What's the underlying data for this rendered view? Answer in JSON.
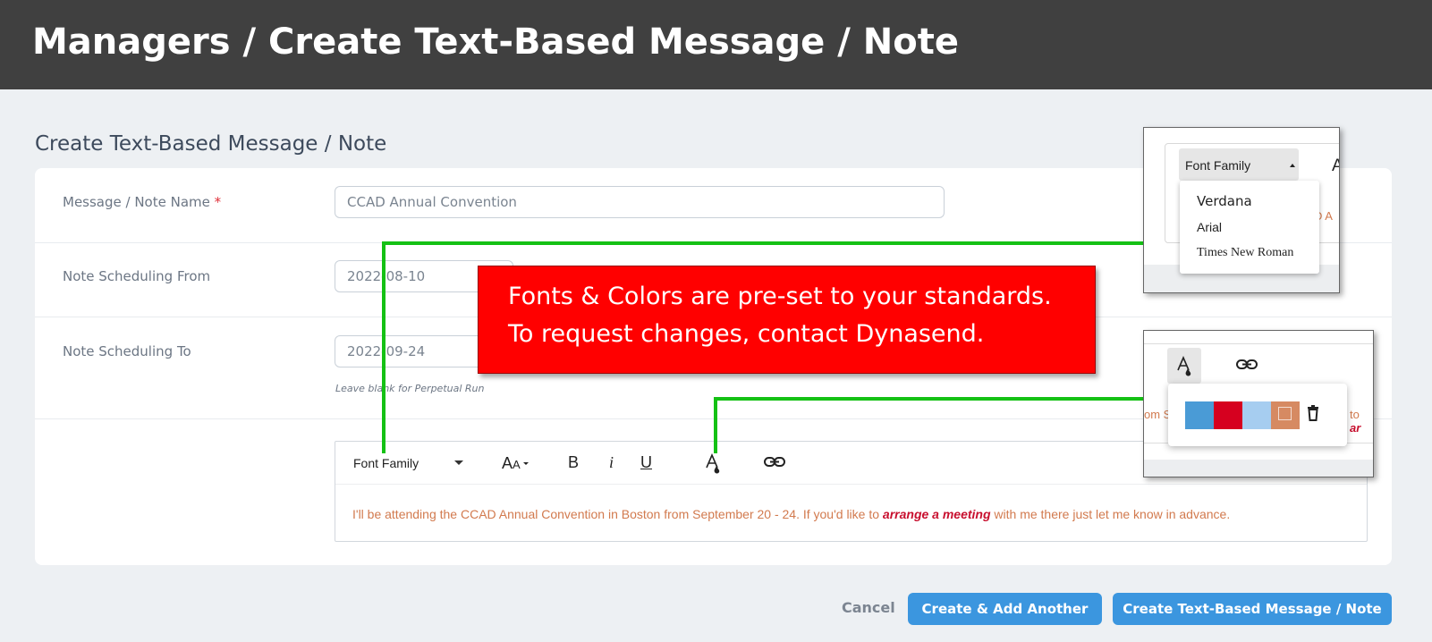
{
  "header": {
    "title": "Managers / Create Text-Based Message / Note"
  },
  "section_title": "Create Text-Based Message / Note",
  "form": {
    "name_label": "Message / Note Name",
    "required_mark": "*",
    "name_value": "CCAD Annual Convention",
    "from_label": "Note Scheduling From",
    "from_value": "2022-08-10",
    "to_label": "Note Scheduling To",
    "to_value": "2022-09-24",
    "to_hint": "Leave blank for Perpetual Run"
  },
  "editor": {
    "font_family_label": "Font Family",
    "size_icon": "font-size-icon",
    "bold": "B",
    "italic": "i",
    "underline": "U",
    "color_icon": "text-color-icon",
    "link_icon": "link-icon",
    "text_before": "I'll be attending the CCAD Annual Convention in Boston from September 20 - 24.  If you'd like to ",
    "text_emphasis": "arrange a meeting",
    "text_after": " with me there just let me know in advance."
  },
  "callout": {
    "line1": "Fonts & Colors are pre-set to your standards.",
    "line2": "To request changes, contact Dynasend."
  },
  "font_panel": {
    "label": "Font Family",
    "options": [
      "Verdana",
      "Arial",
      "Times New Roman"
    ],
    "partial_right": "A",
    "partial_text": "D A"
  },
  "color_panel": {
    "swatches": [
      "#4a9bd6",
      "#d6001f",
      "#a6cdf0",
      "#d68a62"
    ],
    "partial_left": "om S",
    "partial_right": "to",
    "partial_emph": "ar"
  },
  "actions": {
    "cancel": "Cancel",
    "create_add": "Create & Add Another",
    "create": "Create Text-Based Message / Note"
  },
  "colors": {
    "header_bg": "#404040",
    "primary": "#3b96df",
    "callout_bg": "#ff0000",
    "connector": "#14c114",
    "editor_text": "#d27a4e",
    "emphasis": "#c80f2e"
  }
}
